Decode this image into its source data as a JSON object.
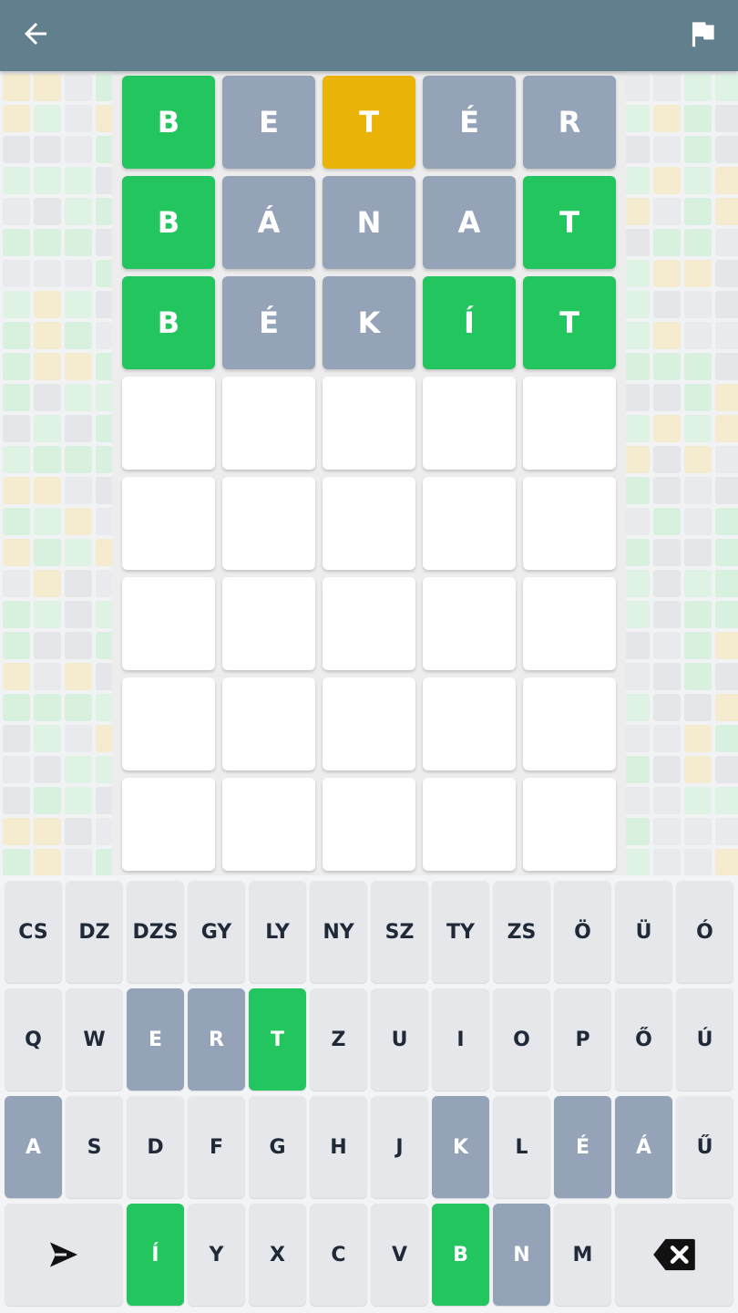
{
  "colors": {
    "header": "#617f8c",
    "correct": "#22c55e",
    "present": "#eab308",
    "absent": "#94a3b8",
    "empty": "#ffffff",
    "key": "#e5e7eb"
  },
  "header": {
    "back_icon": "arrow-left-icon",
    "flag_icon": "flag-icon"
  },
  "board": {
    "rows": [
      [
        {
          "letter": "B",
          "state": "correct"
        },
        {
          "letter": "E",
          "state": "absent"
        },
        {
          "letter": "T",
          "state": "present"
        },
        {
          "letter": "É",
          "state": "absent"
        },
        {
          "letter": "R",
          "state": "absent"
        }
      ],
      [
        {
          "letter": "B",
          "state": "correct"
        },
        {
          "letter": "Á",
          "state": "absent"
        },
        {
          "letter": "N",
          "state": "absent"
        },
        {
          "letter": "A",
          "state": "absent"
        },
        {
          "letter": "T",
          "state": "correct"
        }
      ],
      [
        {
          "letter": "B",
          "state": "correct"
        },
        {
          "letter": "É",
          "state": "absent"
        },
        {
          "letter": "K",
          "state": "absent"
        },
        {
          "letter": "Í",
          "state": "correct"
        },
        {
          "letter": "T",
          "state": "correct"
        }
      ],
      [
        {
          "letter": "",
          "state": "empty"
        },
        {
          "letter": "",
          "state": "empty"
        },
        {
          "letter": "",
          "state": "empty"
        },
        {
          "letter": "",
          "state": "empty"
        },
        {
          "letter": "",
          "state": "empty"
        }
      ],
      [
        {
          "letter": "",
          "state": "empty"
        },
        {
          "letter": "",
          "state": "empty"
        },
        {
          "letter": "",
          "state": "empty"
        },
        {
          "letter": "",
          "state": "empty"
        },
        {
          "letter": "",
          "state": "empty"
        }
      ],
      [
        {
          "letter": "",
          "state": "empty"
        },
        {
          "letter": "",
          "state": "empty"
        },
        {
          "letter": "",
          "state": "empty"
        },
        {
          "letter": "",
          "state": "empty"
        },
        {
          "letter": "",
          "state": "empty"
        }
      ],
      [
        {
          "letter": "",
          "state": "empty"
        },
        {
          "letter": "",
          "state": "empty"
        },
        {
          "letter": "",
          "state": "empty"
        },
        {
          "letter": "",
          "state": "empty"
        },
        {
          "letter": "",
          "state": "empty"
        }
      ],
      [
        {
          "letter": "",
          "state": "empty"
        },
        {
          "letter": "",
          "state": "empty"
        },
        {
          "letter": "",
          "state": "empty"
        },
        {
          "letter": "",
          "state": "empty"
        },
        {
          "letter": "",
          "state": "empty"
        }
      ]
    ]
  },
  "keyboard": {
    "rows": [
      [
        {
          "label": "CS",
          "state": ""
        },
        {
          "label": "DZ",
          "state": ""
        },
        {
          "label": "DZS",
          "state": ""
        },
        {
          "label": "GY",
          "state": ""
        },
        {
          "label": "LY",
          "state": ""
        },
        {
          "label": "NY",
          "state": ""
        },
        {
          "label": "SZ",
          "state": ""
        },
        {
          "label": "TY",
          "state": ""
        },
        {
          "label": "ZS",
          "state": ""
        },
        {
          "label": "Ö",
          "state": ""
        },
        {
          "label": "Ü",
          "state": ""
        },
        {
          "label": "Ó",
          "state": ""
        }
      ],
      [
        {
          "label": "Q",
          "state": ""
        },
        {
          "label": "W",
          "state": ""
        },
        {
          "label": "E",
          "state": "absent"
        },
        {
          "label": "R",
          "state": "absent"
        },
        {
          "label": "T",
          "state": "correct"
        },
        {
          "label": "Z",
          "state": ""
        },
        {
          "label": "U",
          "state": ""
        },
        {
          "label": "I",
          "state": ""
        },
        {
          "label": "O",
          "state": ""
        },
        {
          "label": "P",
          "state": ""
        },
        {
          "label": "Ő",
          "state": ""
        },
        {
          "label": "Ú",
          "state": ""
        }
      ],
      [
        {
          "label": "A",
          "state": "absent"
        },
        {
          "label": "S",
          "state": ""
        },
        {
          "label": "D",
          "state": ""
        },
        {
          "label": "F",
          "state": ""
        },
        {
          "label": "G",
          "state": ""
        },
        {
          "label": "H",
          "state": ""
        },
        {
          "label": "J",
          "state": ""
        },
        {
          "label": "K",
          "state": "absent"
        },
        {
          "label": "L",
          "state": ""
        },
        {
          "label": "É",
          "state": "absent"
        },
        {
          "label": "Á",
          "state": "absent"
        },
        {
          "label": "Ű",
          "state": ""
        }
      ],
      [
        {
          "label": "",
          "state": "",
          "icon": "send-icon",
          "wide": true
        },
        {
          "label": "Í",
          "state": "correct"
        },
        {
          "label": "Y",
          "state": ""
        },
        {
          "label": "X",
          "state": ""
        },
        {
          "label": "C",
          "state": ""
        },
        {
          "label": "V",
          "state": ""
        },
        {
          "label": "B",
          "state": "correct"
        },
        {
          "label": "N",
          "state": "absent"
        },
        {
          "label": "M",
          "state": ""
        },
        {
          "label": "",
          "state": "",
          "icon": "backspace-icon",
          "wide": true
        }
      ]
    ]
  }
}
